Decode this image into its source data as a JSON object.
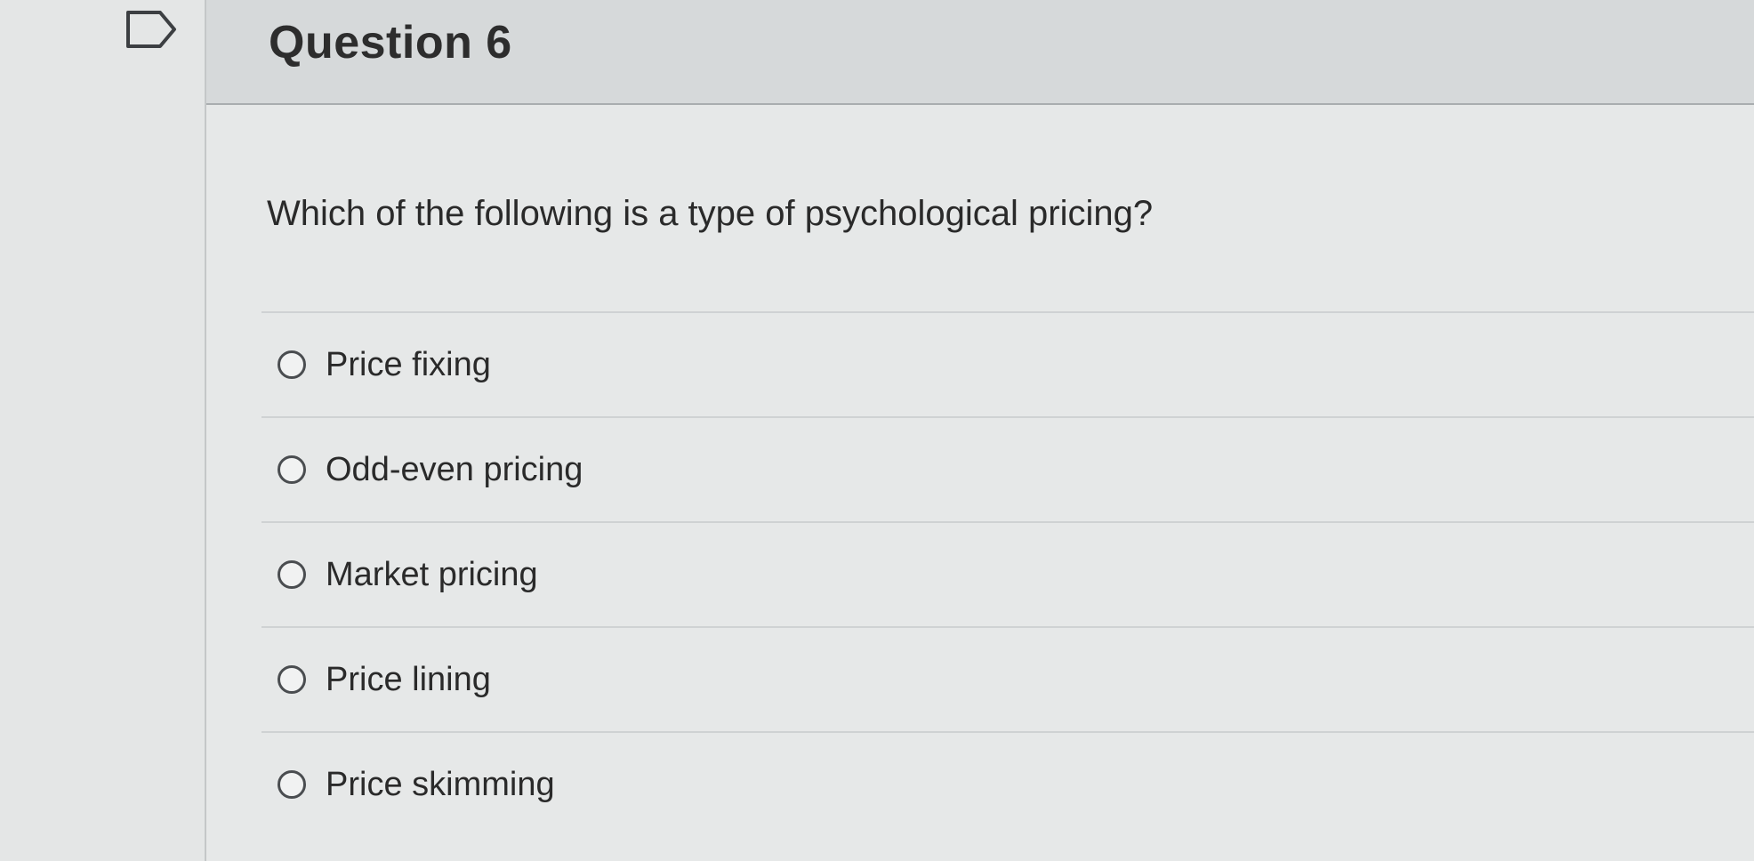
{
  "question": {
    "title": "Question 6",
    "text": "Which of the following is a type of psychological pricing?",
    "answers": [
      {
        "label": "Price fixing"
      },
      {
        "label": "Odd-even pricing"
      },
      {
        "label": "Market pricing"
      },
      {
        "label": "Price lining"
      },
      {
        "label": "Price skimming"
      }
    ]
  },
  "icons": {
    "flag": "flag-icon"
  }
}
